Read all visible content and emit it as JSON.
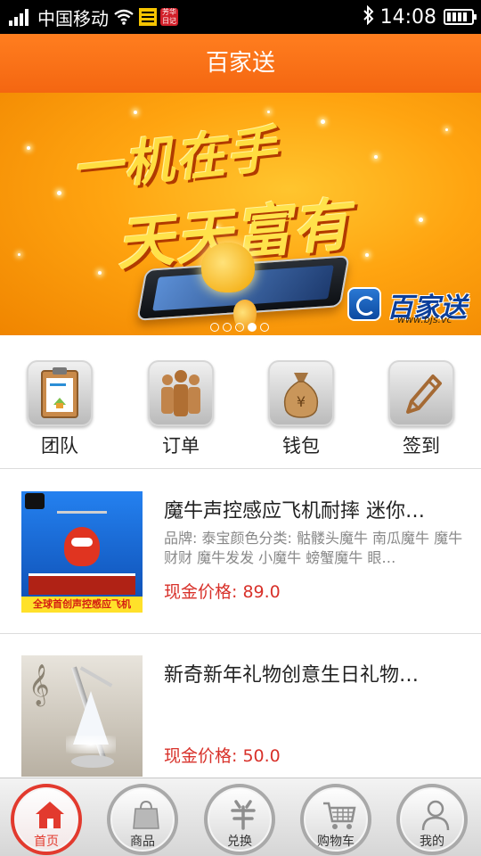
{
  "status_bar": {
    "carrier": "中国移动",
    "time": "14:08",
    "app_icon_text": "芳华\n日记"
  },
  "header": {
    "title": "百家送"
  },
  "banner": {
    "slogan_line1": "一机在手",
    "slogan_line2": "天天富有",
    "brand_name": "百家送",
    "brand_url": "www.bjs.vc",
    "page_count": 5,
    "active_page": 4
  },
  "quick_menu": {
    "items": [
      {
        "label": "团队",
        "icon": "clipboard-icon"
      },
      {
        "label": "订单",
        "icon": "people-icon"
      },
      {
        "label": "钱包",
        "icon": "money-bag-icon"
      },
      {
        "label": "签到",
        "icon": "pencil-icon"
      }
    ]
  },
  "products": [
    {
      "name": "魔牛声控感应飞机耐摔 迷你…",
      "desc": "品牌: 泰宝颜色分类: 骷髅头魔牛 南瓜魔牛 魔牛财财 魔牛发发 小魔牛 螃蟹魔牛 眼…",
      "image_caption": "全球首创声控感应飞机",
      "price_label": "现金价格:",
      "price": "89.0"
    },
    {
      "name": "新奇新年礼物创意生日礼物…",
      "desc": "",
      "price_label": "现金价格:",
      "price": "50.0"
    }
  ],
  "tab_bar": {
    "items": [
      {
        "label": "首页",
        "icon": "home-icon",
        "active": true
      },
      {
        "label": "商品",
        "icon": "shopping-bag-icon",
        "active": false
      },
      {
        "label": "兑换",
        "icon": "exchange-icon",
        "active": false
      },
      {
        "label": "购物车",
        "icon": "cart-icon",
        "active": false
      },
      {
        "label": "我的",
        "icon": "user-icon",
        "active": false
      }
    ]
  },
  "colors": {
    "header": "#f46611",
    "price": "#d8312a",
    "active_tab": "#e23a2e"
  }
}
